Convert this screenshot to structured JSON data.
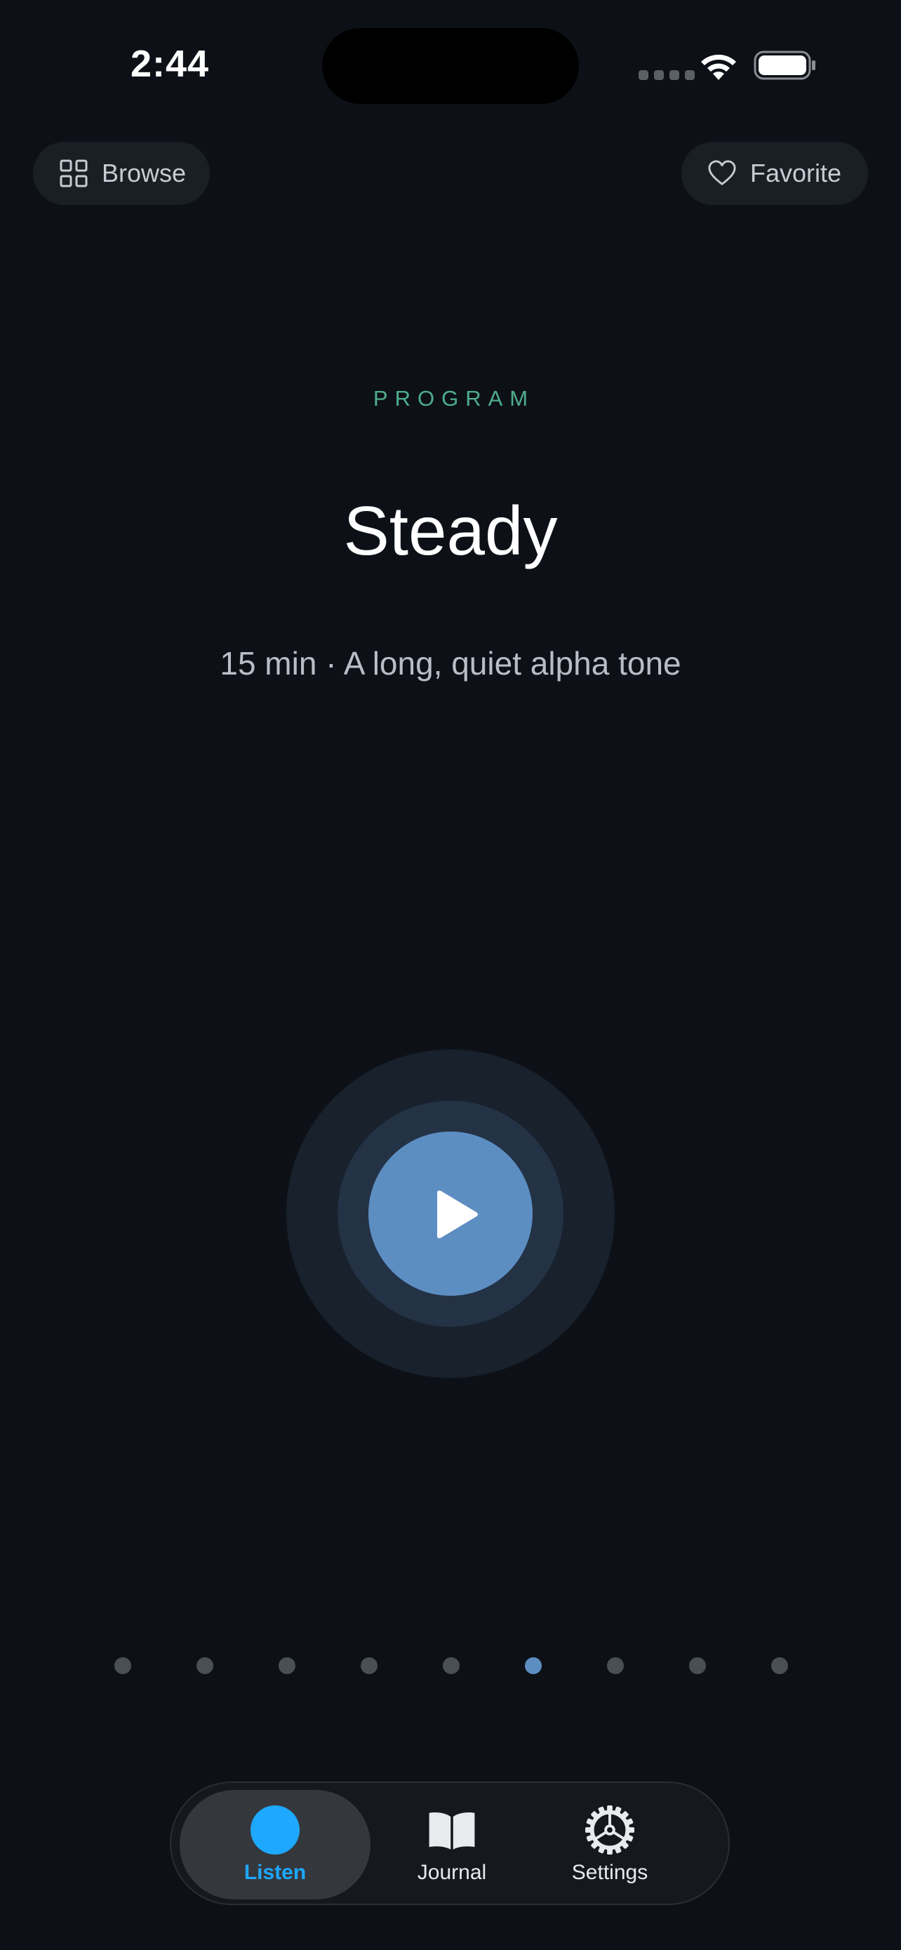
{
  "status_bar": {
    "time": "2:44"
  },
  "top_bar": {
    "browse_label": "Browse",
    "favorite_label": "Favorite"
  },
  "program": {
    "eyebrow": "PROGRAM",
    "title": "Steady",
    "subtitle": "15 min · A long, quiet alpha tone"
  },
  "pager": {
    "count": 9,
    "active_index": 5
  },
  "tabs": [
    {
      "label": "Listen",
      "icon": "listen-dot-icon",
      "selected": true
    },
    {
      "label": "Journal",
      "icon": "book-icon",
      "selected": false
    },
    {
      "label": "Settings",
      "icon": "gear-icon",
      "selected": false
    }
  ],
  "colors": {
    "background": "#0d1117",
    "accent": "#5d8ec2",
    "program_label": "#4fae8d",
    "tab_active": "#1ea8ff"
  }
}
